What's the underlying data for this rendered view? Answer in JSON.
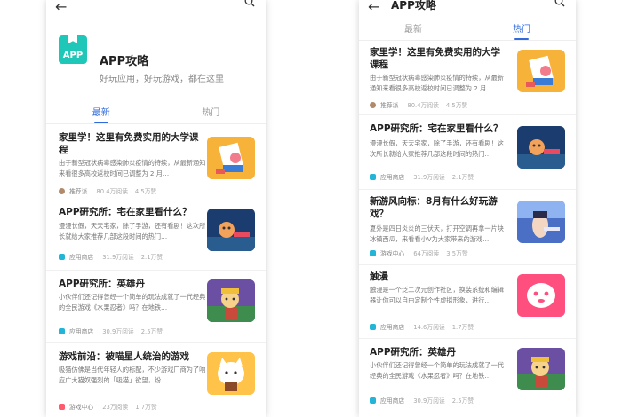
{
  "left": {
    "header": {
      "logo_text": "APP",
      "title": "APP攻略",
      "subtitle": "好玩应用，好玩游戏，都在这里"
    },
    "tabs": [
      "最新",
      "热门"
    ],
    "items": [
      {
        "title": "家里学！这里有免费实用的大学课程",
        "desc": "由于新型冠状病毒感染肺炎疫情的持续，从最新通知来看很多高校返校时间已调整为 2 月…",
        "source": "推荐派",
        "views": "80.4万阅读",
        "likes": "4.5万赞"
      },
      {
        "title": "APP研究所：宅在家里看什么？",
        "desc": "漫漫长假，天天宅家，除了手游，还有看剧！这次所长就给大家推荐几部这段时间的热门…",
        "source": "应用商店",
        "views": "31.9万阅读",
        "likes": "2.1万赞"
      },
      {
        "title": "APP研究所：英雄丹",
        "desc": "小伙伴们还记得曾经一个简单的玩法成就了一代经典的全民游戏《水果忍者》吗？在地铁…",
        "source": "应用商店",
        "views": "30.9万阅读",
        "likes": "2.5万赞"
      },
      {
        "title": "游戏前沿：被喵星人统治的游戏",
        "desc": "吸猫仿佛是当代年轻人的标配，不少游戏厂商为了响应广大猫奴强烈的「吸猫」欲望，纷…",
        "source": "游戏中心",
        "views": "23万阅读",
        "likes": "1.7万赞"
      }
    ]
  },
  "right": {
    "title": "APP攻略",
    "tabs": [
      "最新",
      "热门"
    ],
    "items": [
      {
        "title": "家里学！这里有免费实用的大学课程",
        "desc": "由于新型冠状病毒感染肺炎疫情的持续，从最新通知来看很多高校返校时间已调整为 2 月…",
        "source": "推荐派",
        "views": "80.4万阅读",
        "likes": "4.5万赞"
      },
      {
        "title": "APP研究所：宅在家里看什么？",
        "desc": "漫漫长假，天天宅家，除了手游，还有看剧！这次所长就给大家推荐几部这段时间的热门…",
        "source": "应用商店",
        "views": "31.9万阅读",
        "likes": "2.1万赞"
      },
      {
        "title": "新游风向标：8月有什么好玩游戏？",
        "desc": "夏外是四日炎炎的三伏天，打开空调再拿一片块冰镇西瓜，来看看小V为大家带来的游戏…",
        "source": "游戏中心",
        "views": "64万阅读",
        "likes": "3.5万赞"
      },
      {
        "title": "触漫",
        "desc": "触漫是一个泛二次元创作社区，换装系统和编辑器让你可以自由定制个性虚拟形象，进行…",
        "source": "应用商店",
        "views": "14.6万阅读",
        "likes": "1.7万赞"
      },
      {
        "title": "APP研究所：英雄丹",
        "desc": "小伙伴们还记得曾经一个简单的玩法成就了一代经典的全民游戏《水果忍者》吗？在地铁…",
        "source": "应用商店",
        "views": "30.9万阅读",
        "likes": "2.5万赞"
      }
    ]
  },
  "colors": {
    "accent": "#2f6bdc",
    "logo": "#1fc7b8",
    "source_dot": "#22b5d8",
    "game_dot": "#ff5a6e"
  },
  "icons": {
    "back": "back-arrow-icon",
    "search": "search-icon"
  }
}
